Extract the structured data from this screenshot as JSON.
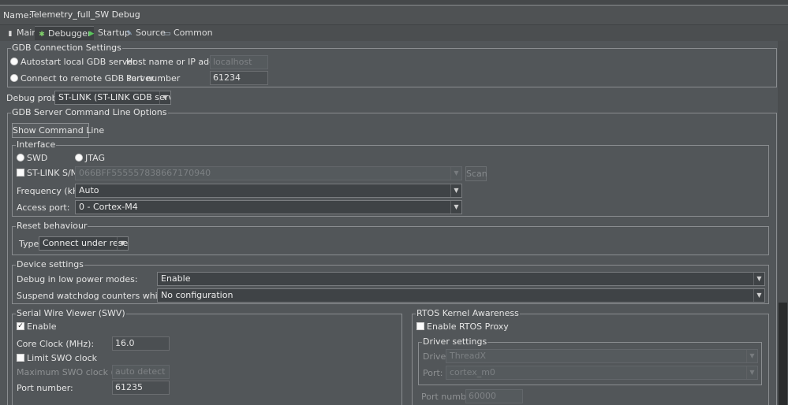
{
  "name_label": "Name:",
  "config_name": "Telemetry_full_SW Debug",
  "tabs": [
    {
      "label": "Main",
      "icon": "page-icon"
    },
    {
      "label": "Debugger",
      "icon": "bug-icon"
    },
    {
      "label": "Startup",
      "icon": "play-icon"
    },
    {
      "label": "Source",
      "icon": "source-icon"
    },
    {
      "label": "Common",
      "icon": "common-icon"
    }
  ],
  "gdb_connection": {
    "title": "GDB Connection Settings",
    "autostart_label": "Autostart local GDB server",
    "remote_label": "Connect to remote GDB server",
    "host_label": "Host name or IP address",
    "host_value": "localhost",
    "port_label": "Port number",
    "port_value": "61234"
  },
  "debug_probe": {
    "label": "Debug probe",
    "value": "ST-LINK (ST-LINK GDB server)"
  },
  "server_options": {
    "title": "GDB Server Command Line Options",
    "show_cmd_label": "Show Command Line"
  },
  "interface": {
    "title": "Interface",
    "swd_label": "SWD",
    "jtag_label": "JTAG",
    "stlink_sn_label": "ST-LINK S/N",
    "stlink_sn_value": "066BFF555557838667170940",
    "scan_label": "Scan",
    "frequency_label": "Frequency (kHz):",
    "frequency_value": "Auto",
    "access_port_label": "Access port:",
    "access_port_value": "0 - Cortex-M4"
  },
  "reset": {
    "title": "Reset behaviour",
    "type_label": "Type:",
    "type_value": "Connect under reset"
  },
  "device": {
    "title": "Device settings",
    "low_power_label": "Debug in low power modes:",
    "low_power_value": "Enable",
    "watchdog_label": "Suspend watchdog counters while halted:",
    "watchdog_value": "No configuration"
  },
  "swv": {
    "title": "Serial Wire Viewer (SWV)",
    "enable_label": "Enable",
    "core_clock_label": "Core Clock (MHz):",
    "core_clock_value": "16.0",
    "limit_swo_label": "Limit SWO clock",
    "max_swo_label": "Maximum SWO clock (kHz):",
    "max_swo_value": "auto detect",
    "port_label": "Port number:",
    "port_value": "61235"
  },
  "rtos": {
    "title": "RTOS Kernel Awareness",
    "enable_proxy_label": "Enable RTOS Proxy",
    "driver_settings_title": "Driver settings",
    "driver_label": "Driver:",
    "driver_value": "ThreadX",
    "port_label": "Port:",
    "port_value": "cortex_m0",
    "port_number_label": "Port number:",
    "port_number_value": "60000"
  }
}
